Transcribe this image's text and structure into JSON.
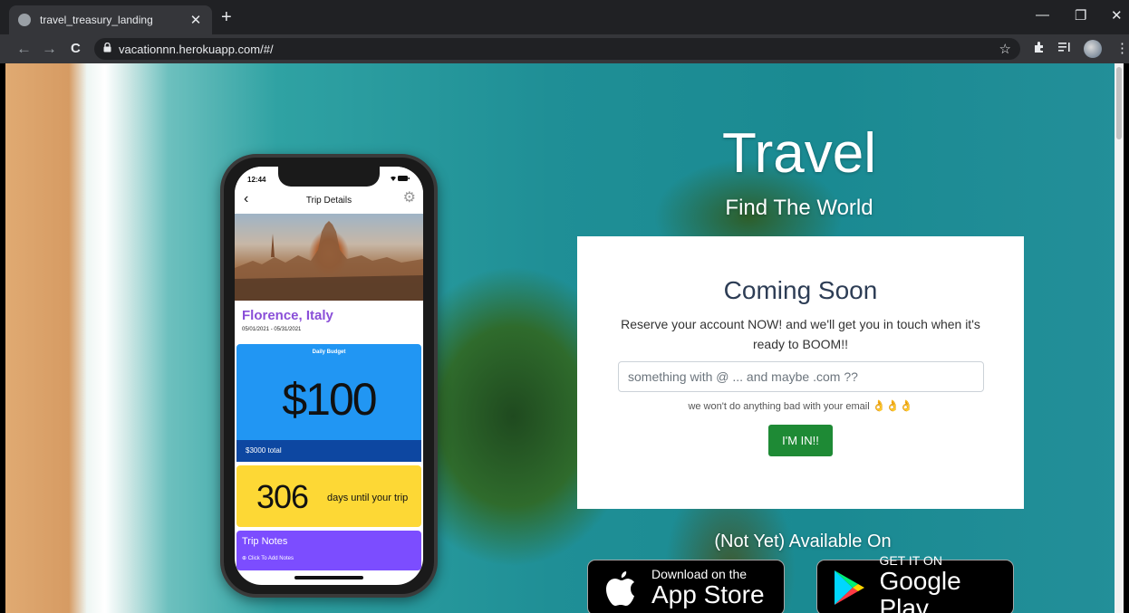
{
  "browser": {
    "tab_title": "travel_treasury_landing",
    "tab_close": "✕",
    "new_tab": "+",
    "back": "←",
    "forward": "→",
    "reload": "C",
    "url": "vacationnn.herokuapp.com/#/",
    "bookmark": "☆",
    "minimize": "—",
    "restore": "❐",
    "close": "✕",
    "menu": "⋮"
  },
  "hero": {
    "title": "Travel",
    "subtitle": "Find The World"
  },
  "signup": {
    "heading": "Coming Soon",
    "description": "Reserve your account NOW! and we'll get you in touch when it's ready to BOOM!!",
    "email_placeholder": "something with @ ... and maybe .com ??",
    "note": "we won't do anything bad with your email",
    "button_label": "I'M IN!!"
  },
  "availability": {
    "label": "(Not Yet) Available On",
    "apple_line1": "Download on the",
    "apple_line2": "App Store",
    "google_line1": "GET IT ON",
    "google_line2": "Google Play"
  },
  "phone": {
    "time": "12:44",
    "header_title": "Trip Details",
    "city": "Florence, Italy",
    "dates": "05/01/2021 - 05/31/2021",
    "budget_label": "Daily Budget",
    "budget_amount": "$100",
    "total": "$3000 total",
    "days_number": "306",
    "days_label": "days until your trip",
    "notes_title": "Trip Notes",
    "notes_add": "⊕  Click To Add Notes"
  }
}
